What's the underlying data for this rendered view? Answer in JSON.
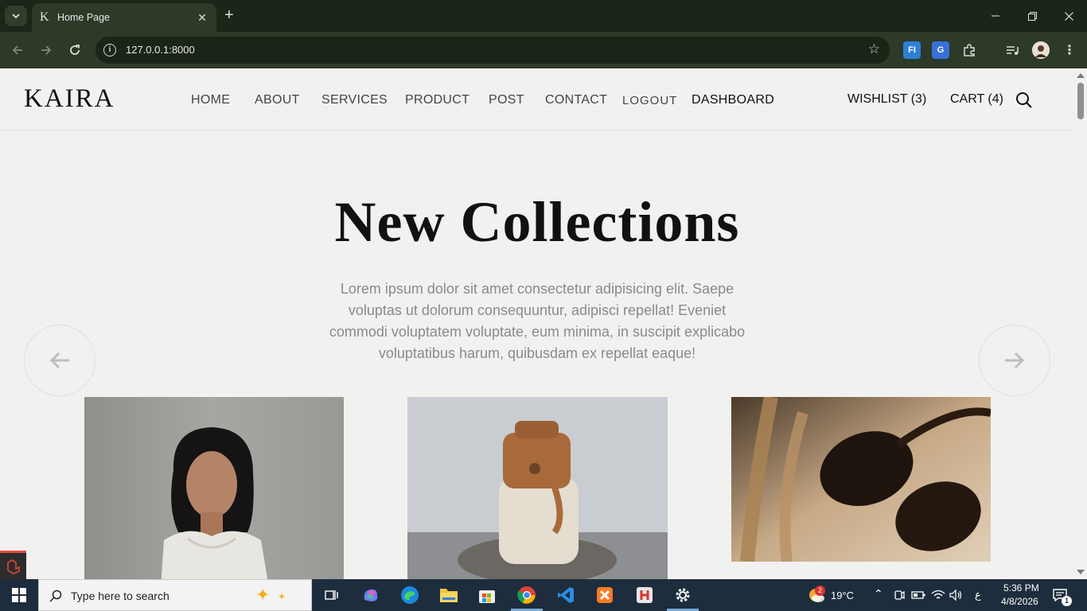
{
  "browser": {
    "tab_title": "Home Page",
    "tab_favicon": "K",
    "url": "127.0.0.1:8000"
  },
  "site": {
    "logo": "KAIRA",
    "nav": {
      "home": "HOME",
      "about": "ABOUT",
      "services": "SERVICES",
      "product": "PRODUCT",
      "post": "POST",
      "contact": "CONTACT",
      "logout": "LOGOUT",
      "dashboard": "DASHBOARD"
    },
    "wishlist": "WISHLIST (3)",
    "cart": "CART (4)"
  },
  "hero": {
    "title": "New Collections",
    "text": "Lorem ipsum dolor sit amet consectetur adipisicing elit. Saepe voluptas ut dolorum consequuntur, adipisci repellat! Eveniet commodi voluptatem voluptate, eum minima, in suscipit explicabo voluptatibus harum, quibusdam ex repellat eaque!"
  },
  "taskbar": {
    "search_placeholder": "Type here to search",
    "weather": "19°C",
    "weather_badge": "2",
    "time": "5:36 PM",
    "date": "4/8/2026",
    "lang": "ع",
    "notifications": "1"
  },
  "colors": {
    "chrome_dark": "#1a2617",
    "chrome_toolbar": "#2c3a27",
    "page_bg": "#f1f1f0",
    "taskbar_bg": "#1d2d3d"
  }
}
